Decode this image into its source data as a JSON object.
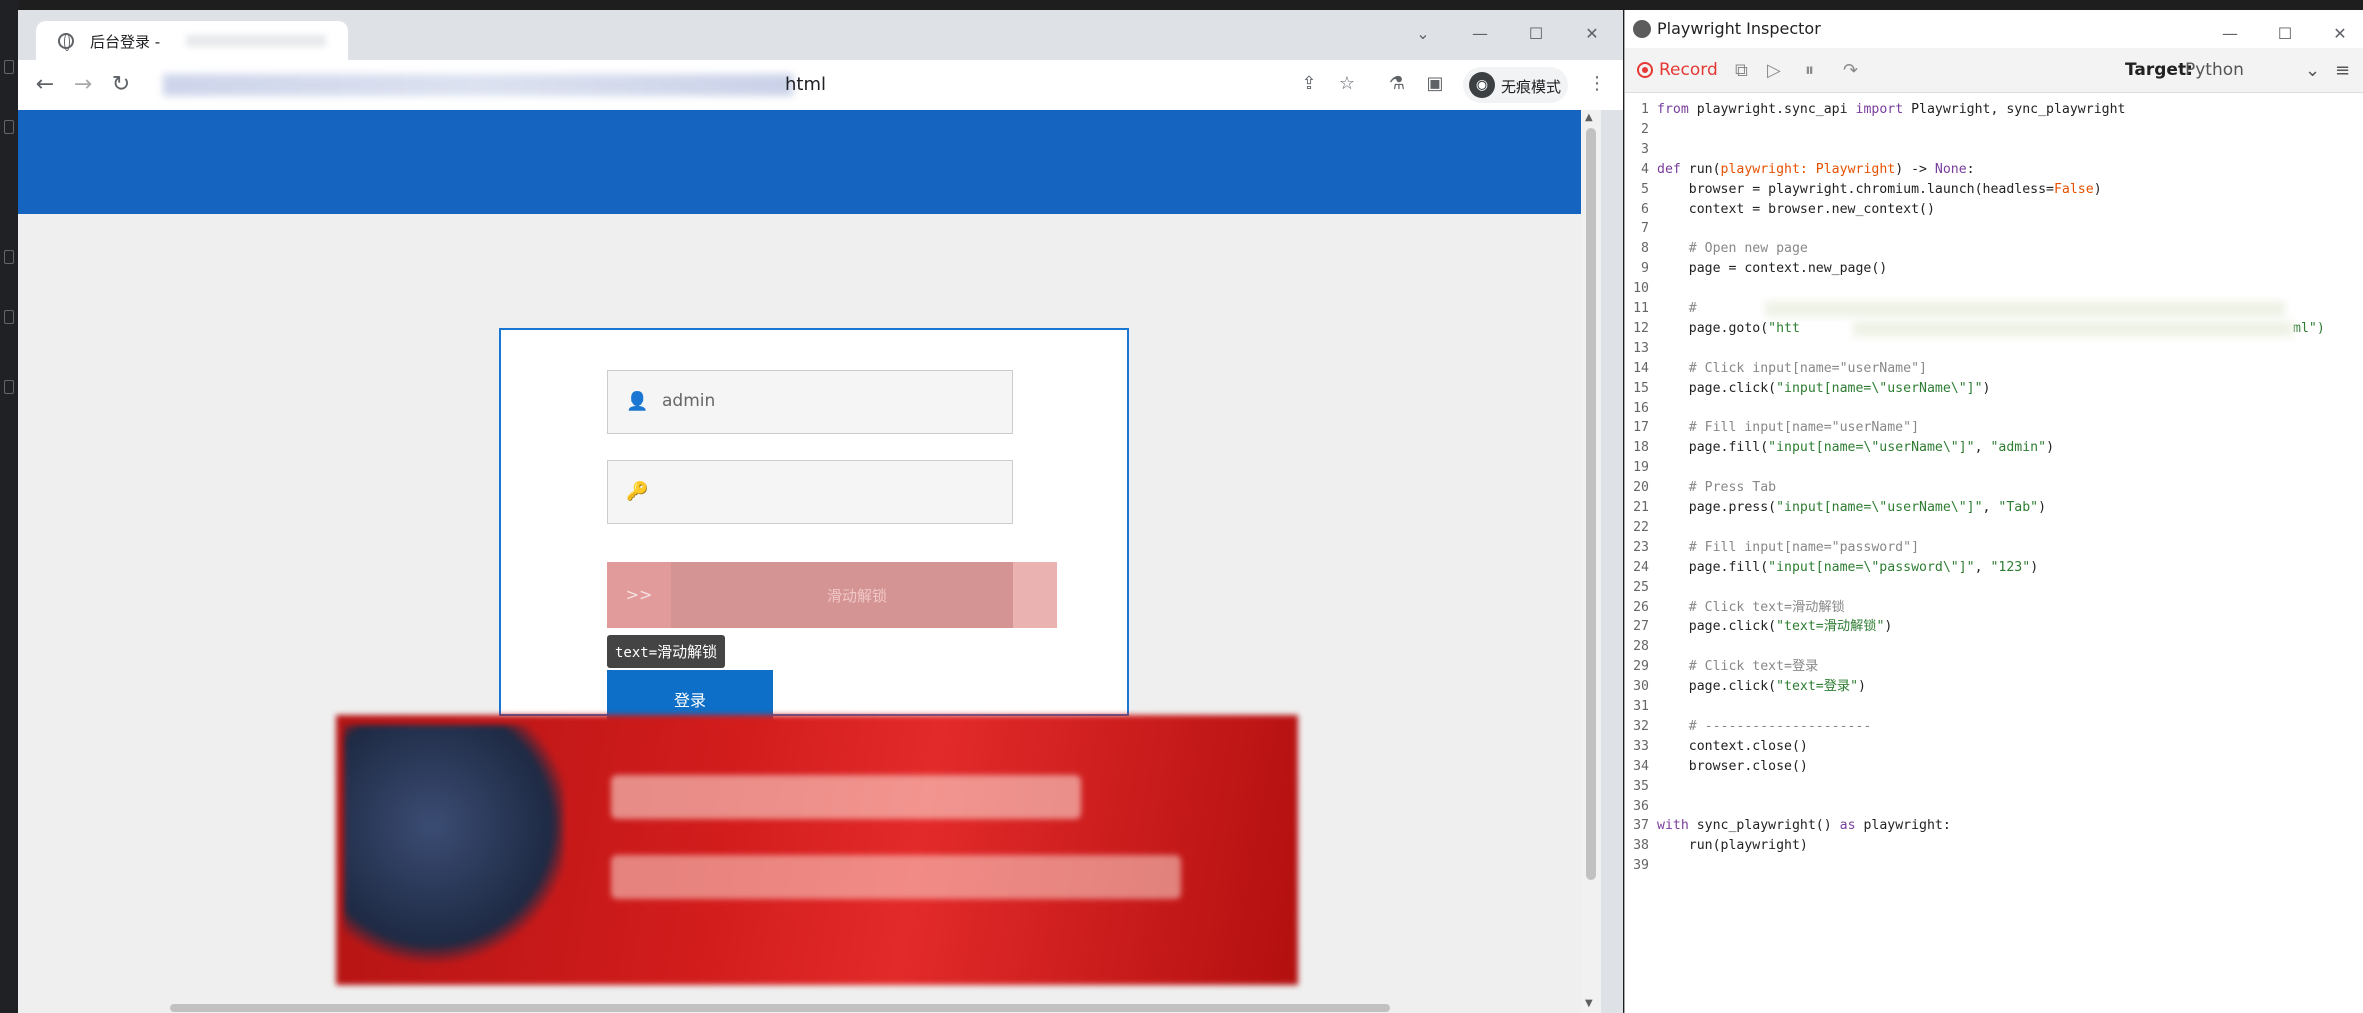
{
  "browser": {
    "tab_title": "后台登录 -",
    "url_suffix": "html",
    "incognito_label": "无痕模式"
  },
  "page": {
    "username_value": "admin",
    "password_value": "",
    "slider_text": "滑动解锁",
    "tooltip_prefix": "text=",
    "tooltip_text": "滑动解锁",
    "login_button": "登录",
    "colors": {
      "header_blue": "#1565c0",
      "login_button": "#0d6fc7",
      "slider_red": "#d59494"
    }
  },
  "inspector": {
    "title": "Playwright Inspector",
    "record_label": "Record",
    "target_label": "Target:",
    "target_value": "Python",
    "code_lines": [
      "from playwright.sync_api import Playwright, sync_playwright",
      "",
      "",
      "def run(playwright: Playwright) -> None:",
      "    browser = playwright.chromium.launch(headless=False)",
      "    context = browser.new_context()",
      "",
      "    # Open new page",
      "    page = context.new_page()",
      "",
      "    #",
      "    page.goto(\"htt",
      "",
      "    # Click input[name=\"userName\"]",
      "    page.click(\"input[name=\\\"userName\\\"]\")",
      "",
      "    # Fill input[name=\"userName\"]",
      "    page.fill(\"input[name=\\\"userName\\\"]\", \"admin\")",
      "",
      "    # Press Tab",
      "    page.press(\"input[name=\\\"userName\\\"]\", \"Tab\")",
      "",
      "    # Fill input[name=\"password\"]",
      "    page.fill(\"input[name=\\\"password\\\"]\", \"123\")",
      "",
      "    # Click text=滑动解锁",
      "    page.click(\"text=滑动解锁\")",
      "",
      "    # Click text=登录",
      "    page.click(\"text=登录\")",
      "",
      "    # ---------------------",
      "    context.close()",
      "    browser.close()",
      "",
      "",
      "with sync_playwright() as playwright:",
      "    run(playwright)",
      ""
    ],
    "goto_tail": "ml\")"
  }
}
